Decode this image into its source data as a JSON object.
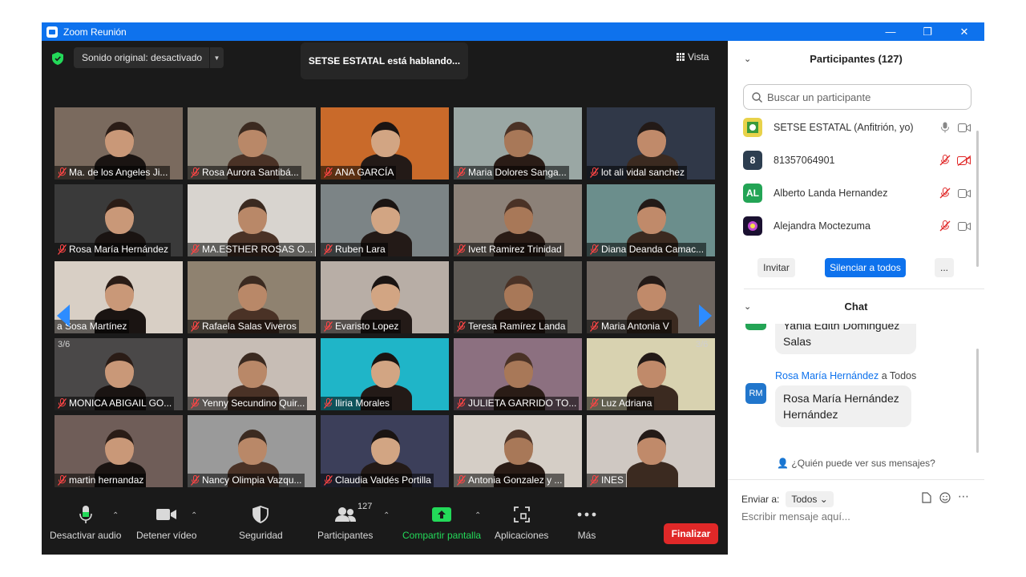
{
  "window": {
    "title": "Zoom Reunión"
  },
  "header": {
    "audio_select": "Sonido original: desactivado",
    "speaking_banner": "SETSE ESTATAL está hablando...",
    "view_label": "Vista"
  },
  "gallery": {
    "page_left": "3/6",
    "page_right": "3/6",
    "tiles": [
      {
        "name": "Ma. de los Angeles Ji...",
        "muted": true,
        "bg": "#7a6a5e"
      },
      {
        "name": "Rosa Aurora Santibá...",
        "muted": true,
        "bg": "#8a8478"
      },
      {
        "name": "ANA GARCÍA",
        "muted": true,
        "bg": "#c96a2a"
      },
      {
        "name": "Maria Dolores Sanga...",
        "muted": true,
        "bg": "#9aa7a4"
      },
      {
        "name": "lot ali vidal sanchez",
        "muted": true,
        "bg": "#303848"
      },
      {
        "name": "Rosa María Hernández",
        "muted": true,
        "bg": "#3a3a3a"
      },
      {
        "name": "MA.ESTHER ROSAS O...",
        "muted": true,
        "bg": "#d8d4cf"
      },
      {
        "name": "Ruben Lara",
        "muted": true,
        "bg": "#7c8486"
      },
      {
        "name": "Ivett Ramirez Trinidad",
        "muted": true,
        "bg": "#8c8178"
      },
      {
        "name": "Diana Deanda Camac...",
        "muted": true,
        "bg": "#6b8e8c"
      },
      {
        "name": "a Sosa Martínez",
        "muted": false,
        "bg": "#d8cfc5"
      },
      {
        "name": "Rafaela Salas Viveros",
        "muted": true,
        "bg": "#8f8270"
      },
      {
        "name": "Evaristo Lopez",
        "muted": true,
        "bg": "#b8aea6"
      },
      {
        "name": "Teresa Ramírez Landa",
        "muted": true,
        "bg": "#5e5a55"
      },
      {
        "name": "Maria Antonia V",
        "muted": true,
        "bg": "#6e6660"
      },
      {
        "name": "MONICA ABIGAIL GO...",
        "muted": true,
        "bg": "#4a4848"
      },
      {
        "name": "Yenny Secundino Quir...",
        "muted": true,
        "bg": "#c7bdb5"
      },
      {
        "name": "Iliria Morales",
        "muted": true,
        "bg": "#1fb5c8"
      },
      {
        "name": "JULIETA GARRIDO TO...",
        "muted": true,
        "bg": "#8c7080"
      },
      {
        "name": "Luz Adriana",
        "muted": true,
        "bg": "#d8d2b0"
      },
      {
        "name": "martin hernandaz",
        "muted": true,
        "bg": "#6f5d58"
      },
      {
        "name": "Nancy Olimpia Vazqu...",
        "muted": true,
        "bg": "#9a9a9a"
      },
      {
        "name": "Claudia Valdés Portilla",
        "muted": true,
        "bg": "#3c3f5a"
      },
      {
        "name": "Antonia Gonzalez y ...",
        "muted": true,
        "bg": "#d5cec6"
      },
      {
        "name": "INES",
        "muted": true,
        "bg": "#cfc8c2"
      }
    ]
  },
  "toolbar": {
    "audio": "Desactivar audio",
    "video": "Detener vídeo",
    "security": "Seguridad",
    "participants": "Participantes",
    "participants_count": "127",
    "share": "Compartir pantalla",
    "apps": "Aplicaciones",
    "more": "Más",
    "end": "Finalizar"
  },
  "participants_panel": {
    "title": "Participantes (127)",
    "search_placeholder": "Buscar un participante",
    "list": [
      {
        "name": "SETSE ESTATAL (Anfitrión, yo)",
        "avatar": "",
        "avatar_color": "#e8d24a"
      },
      {
        "name": "81357064901",
        "avatar": "8",
        "avatar_color": "#2d3e50"
      },
      {
        "name": "Alberto Landa Hernandez",
        "avatar": "AL",
        "avatar_color": "#23a455"
      },
      {
        "name": "Alejandra Moctezuma",
        "avatar": "",
        "avatar_color": "#1a1030"
      }
    ],
    "invite": "Invitar",
    "mute_all": "Silenciar a todos",
    "more": "..."
  },
  "chat": {
    "title": "Chat",
    "partial_message": "Yania Edith Dominguez Salas",
    "partial_line1": "Yania Edith Dominguez",
    "partial_line2": "Salas",
    "sender": "Rosa María Hernández",
    "sender_to": " a Todos",
    "avatar": "RM",
    "message_line1": "Rosa María Hernández",
    "message_line2": "Hernández",
    "who_can_see": "¿Quién puede ver sus mensajes?",
    "send_to_label": "Enviar a:",
    "send_to_value": "Todos",
    "input_placeholder": "Escribir mensaje aquí..."
  }
}
